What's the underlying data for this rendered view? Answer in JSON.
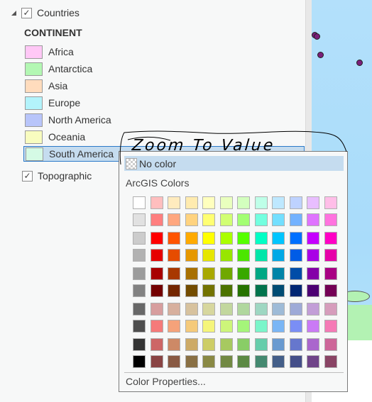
{
  "layers": {
    "countries": {
      "label": "Countries",
      "checked": true,
      "check_glyph": "✓"
    },
    "topographic": {
      "label": "Topographic",
      "checked": true,
      "check_glyph": "✓"
    }
  },
  "legend": {
    "heading": "CONTINENT",
    "items": [
      {
        "label": "Africa",
        "color": "#ffc8f6"
      },
      {
        "label": "Antarctica",
        "color": "#b3f7b3"
      },
      {
        "label": "Asia",
        "color": "#ffdcbd"
      },
      {
        "label": "Europe",
        "color": "#b3f3fb"
      },
      {
        "label": "North America",
        "color": "#b8c5fa"
      },
      {
        "label": "Oceania",
        "color": "#f8fcbf"
      },
      {
        "label": "South America",
        "color": "#d5fae5",
        "selected": true
      }
    ]
  },
  "annotation": {
    "text": "Zoom To Value"
  },
  "color_picker": {
    "no_color_label": "No color",
    "section_label": "ArcGIS Colors",
    "footer_label": "Color Properties...",
    "palette": [
      [
        "#ffffff",
        "#ffbebe",
        "#ffebbe",
        "#ffebaf",
        "#ffffbe",
        "#e9ffbe",
        "#d3ffbe",
        "#beffe8",
        "#bee8ff",
        "#bed2ff",
        "#e8beff",
        "#ffbee8"
      ],
      [
        "#e1e1e1",
        "#ff7f7f",
        "#ffa77f",
        "#ffd37f",
        "#ffff73",
        "#d1ff73",
        "#a3ff73",
        "#73ffdf",
        "#73dfff",
        "#73b2ff",
        "#df73ff",
        "#ff73df"
      ],
      [
        "#cccccc",
        "#ff0000",
        "#ff5500",
        "#ffaa00",
        "#ffff00",
        "#aaff00",
        "#55ff00",
        "#00ffc5",
        "#00c5ff",
        "#0070ff",
        "#c500ff",
        "#ff00c5"
      ],
      [
        "#b2b2b2",
        "#e60000",
        "#e64c00",
        "#e69800",
        "#e6e600",
        "#98e600",
        "#4ce600",
        "#00e6a9",
        "#00a9e6",
        "#005ce6",
        "#a900e6",
        "#e600a9"
      ],
      [
        "#9c9c9c",
        "#a80000",
        "#a83800",
        "#a87000",
        "#a8a800",
        "#70a800",
        "#38a800",
        "#00a884",
        "#0084a8",
        "#004da8",
        "#8400a8",
        "#a80084"
      ],
      [
        "#828282",
        "#730000",
        "#732600",
        "#734c00",
        "#737300",
        "#4c7300",
        "#267300",
        "#00734c",
        "#004c73",
        "#002673",
        "#4c0073",
        "#730055"
      ],
      [
        "#686868",
        "#d79e9e",
        "#d7b09e",
        "#d7c29e",
        "#d7d79e",
        "#c2d79e",
        "#b0d79e",
        "#9ed7c2",
        "#9ebbd7",
        "#9eaad7",
        "#c29ed7",
        "#d69dbc"
      ],
      [
        "#4e4e4e",
        "#f57a7a",
        "#f5a27a",
        "#f5ca7a",
        "#f5f57a",
        "#cdf57a",
        "#a5f57a",
        "#7af5ca",
        "#7ab6f5",
        "#7a8ef5",
        "#ca7af5",
        "#f57ab6"
      ],
      [
        "#343434",
        "#cd6666",
        "#cd8966",
        "#cdaa66",
        "#cdcd66",
        "#a7c960",
        "#89cd66",
        "#66cdab",
        "#699ad0",
        "#6677cd",
        "#aa66cd",
        "#cd6699"
      ],
      [
        "#000000",
        "#894444",
        "#895a44",
        "#897044",
        "#898944",
        "#728944",
        "#5c8944",
        "#448970",
        "#445f89",
        "#444f89",
        "#704489",
        "#894465"
      ]
    ]
  }
}
